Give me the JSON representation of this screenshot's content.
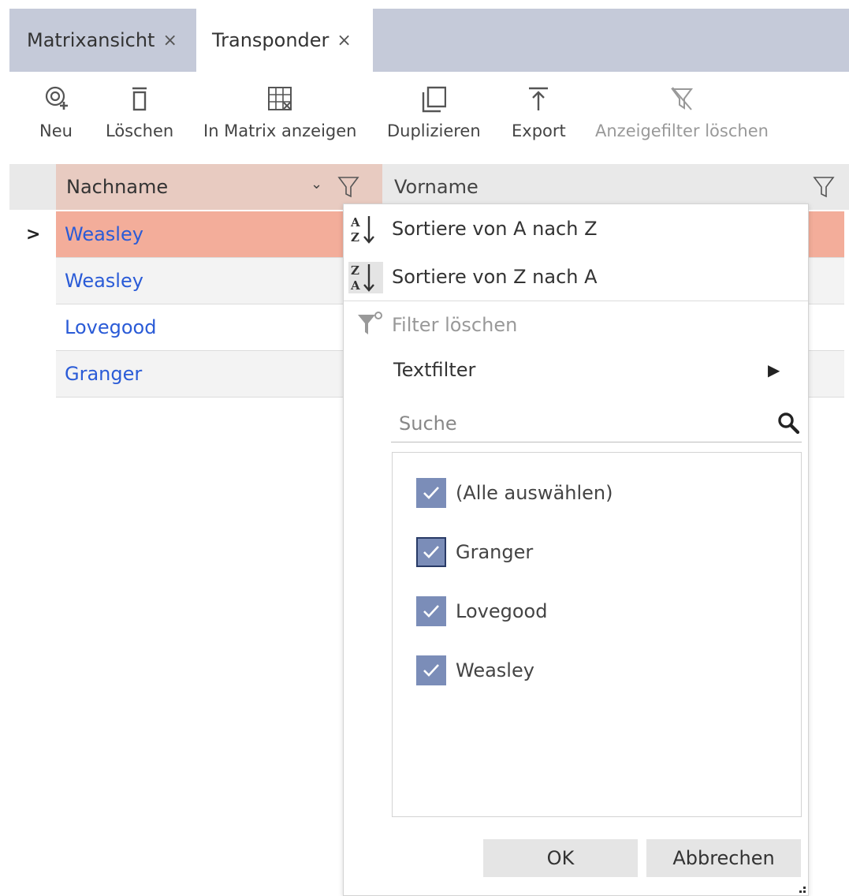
{
  "tabs": [
    {
      "label": "Matrixansicht",
      "close": "×"
    },
    {
      "label": "Transponder",
      "close": "×"
    }
  ],
  "toolbar": {
    "new": "Neu",
    "delete": "Löschen",
    "show_matrix": "In Matrix anzeigen",
    "duplicate": "Duplizieren",
    "export": "Export",
    "clear_filter": "Anzeigefilter löschen"
  },
  "grid": {
    "columns": [
      {
        "label": "Nachname"
      },
      {
        "label": "Vorname"
      }
    ],
    "rows": [
      {
        "nachname": "Weasley"
      },
      {
        "nachname": "Weasley"
      },
      {
        "nachname": "Lovegood"
      },
      {
        "nachname": "Granger"
      }
    ],
    "selected_indicator": ">"
  },
  "filter_menu": {
    "sort_asc": "Sortiere von A nach Z",
    "sort_desc": "Sortiere von Z nach A",
    "clear": "Filter löschen",
    "text_filter": "Textfilter",
    "search_placeholder": "Suche",
    "items": [
      {
        "label": "(Alle auswählen)",
        "checked": true
      },
      {
        "label": "Granger",
        "checked": true
      },
      {
        "label": "Lovegood",
        "checked": true
      },
      {
        "label": "Weasley",
        "checked": true
      }
    ],
    "ok": "OK",
    "cancel": "Abbrechen"
  },
  "colors": {
    "tabbar": "#c5cad9",
    "selected_row": "#f3ad9a",
    "sorted_header": "#e8cbc1",
    "checkbox": "#7b8db8",
    "link_text": "#2a5bd7"
  }
}
